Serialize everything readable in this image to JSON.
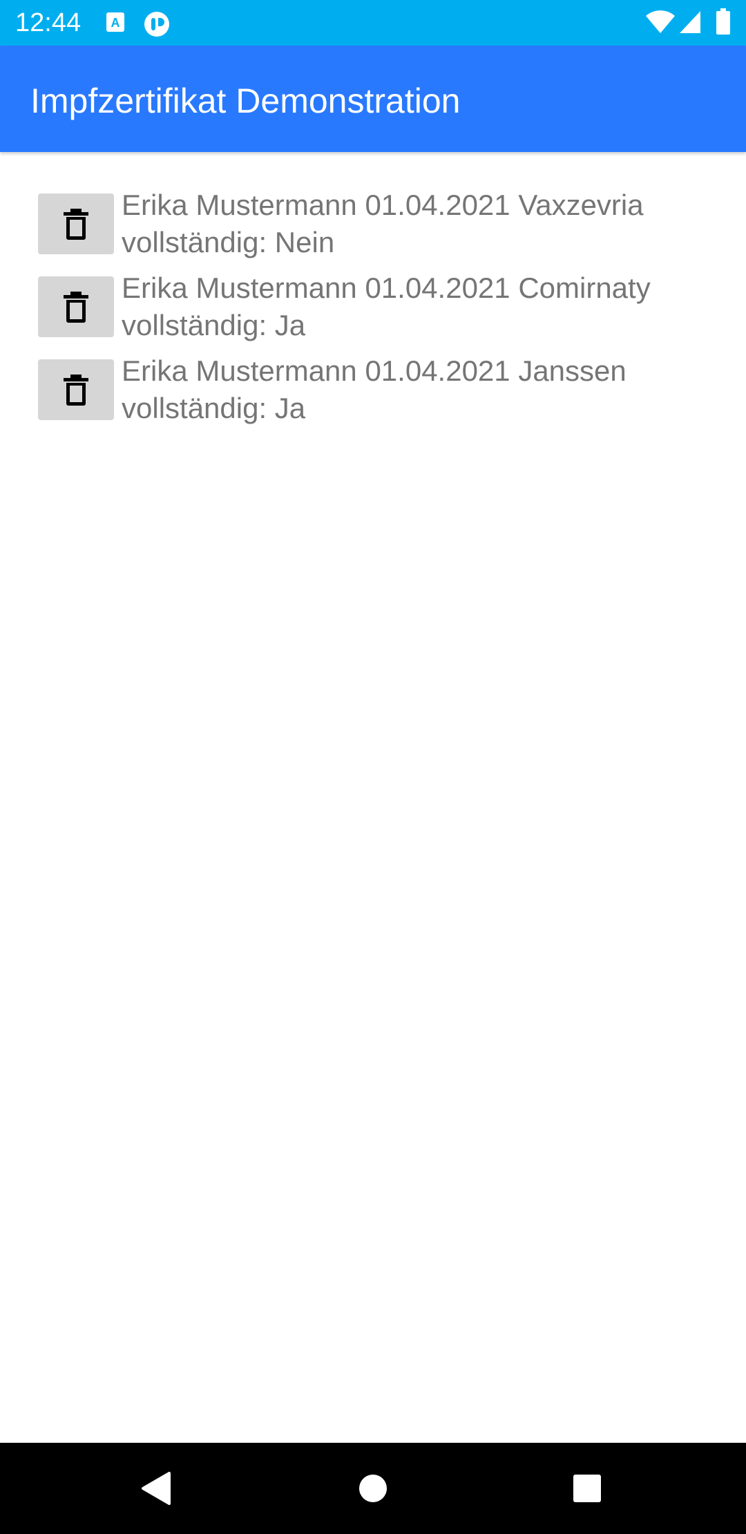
{
  "status_bar": {
    "time": "12:44",
    "background": "#00AEEF",
    "left_icons": [
      "notification-a-icon",
      "notification-app-icon"
    ],
    "right_icons": [
      "wifi-icon",
      "cellular-signal-icon",
      "battery-icon"
    ]
  },
  "app_bar": {
    "title": "Impfzertifikat Demonstration",
    "background": "#2979FF"
  },
  "certificates": [
    {
      "line1": "Erika Mustermann 01.04.2021 Vaxzevria",
      "line2": "vollständig: Nein",
      "delete_icon": "trash-icon"
    },
    {
      "line1": "Erika Mustermann 01.04.2021 Comirnaty",
      "line2": "vollständig: Ja",
      "delete_icon": "trash-icon"
    },
    {
      "line1": "Erika Mustermann 01.04.2021 Janssen",
      "line2": "vollständig: Ja",
      "delete_icon": "trash-icon"
    }
  ],
  "nav_bar": {
    "buttons": [
      "back-icon",
      "home-icon",
      "recents-icon"
    ]
  }
}
